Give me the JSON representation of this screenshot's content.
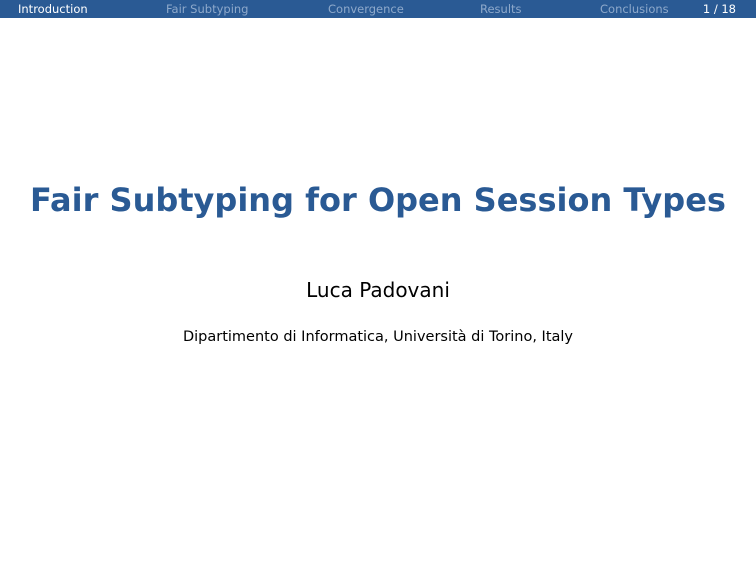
{
  "nav": {
    "sections": [
      {
        "label": "Introduction",
        "active": true
      },
      {
        "label": "Fair Subtyping",
        "active": false
      },
      {
        "label": "Convergence",
        "active": false
      },
      {
        "label": "Results",
        "active": false
      },
      {
        "label": "Conclusions",
        "active": false
      }
    ],
    "page_counter": "1 / 18"
  },
  "slide": {
    "title": "Fair Subtyping for Open Session Types",
    "author": "Luca Padovani",
    "institute": "Dipartimento di Informatica, Università di Torino, Italy"
  },
  "colors": {
    "accent": "#2a5a94",
    "nav_inactive": "#8ea9cb",
    "nav_active": "#ffffff"
  }
}
